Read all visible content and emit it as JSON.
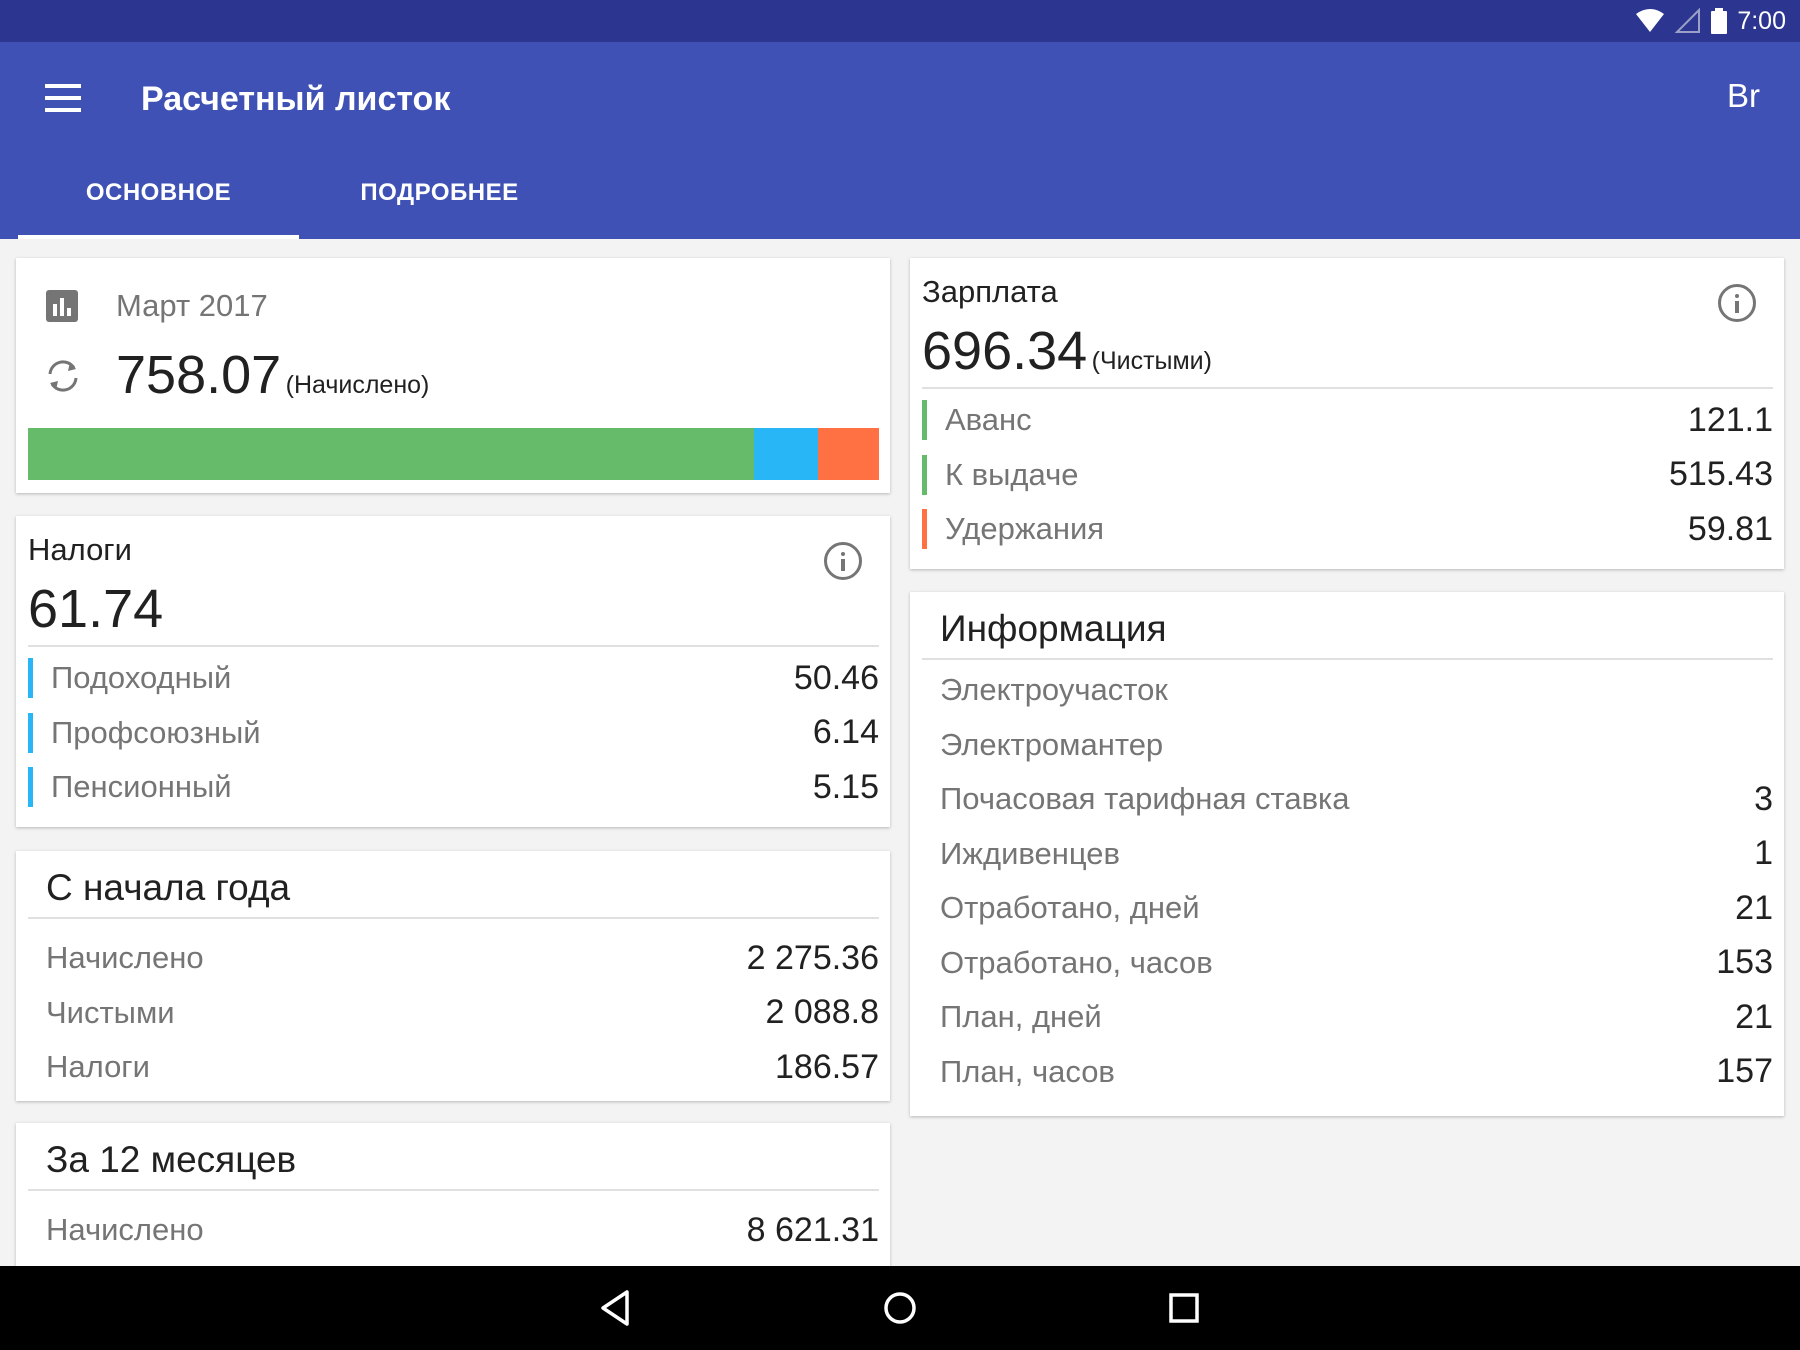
{
  "status_bar": {
    "time": "7:00"
  },
  "app_bar": {
    "title": "Расчетный листок",
    "currency": "Br",
    "tabs": [
      {
        "label": "ОСНОВНОЕ",
        "selected": true
      },
      {
        "label": "ПОДРОБНЕЕ",
        "selected": false
      }
    ]
  },
  "summary": {
    "period": "Март 2017",
    "total": "758.07",
    "total_note": "(Начислено)",
    "bar": [
      {
        "name": "net",
        "fraction": 0.853,
        "color": "#66bb6a"
      },
      {
        "name": "taxes",
        "fraction": 0.075,
        "color": "#29b6f6"
      },
      {
        "name": "deductions",
        "fraction": 0.072,
        "color": "#ff7043"
      }
    ]
  },
  "taxes": {
    "title": "Налоги",
    "total": "61.74",
    "items": [
      {
        "label": "Подоходный",
        "value": "50.46"
      },
      {
        "label": "Профсоюзный",
        "value": "6.14"
      },
      {
        "label": "Пенсионный",
        "value": "5.15"
      }
    ],
    "accent_color": "#29b6f6"
  },
  "ytd": {
    "title": "С начала года",
    "items": [
      {
        "label": "Начислено",
        "value": "2 275.36"
      },
      {
        "label": "Чистыми",
        "value": "2 088.8"
      },
      {
        "label": "Налоги",
        "value": "186.57"
      }
    ]
  },
  "months12": {
    "title": "За 12 месяцев",
    "items": [
      {
        "label": "Начислено",
        "value": "8 621.31"
      }
    ]
  },
  "salary": {
    "title": "Зарплата",
    "total": "696.34",
    "total_note": "(Чистыми)",
    "items": [
      {
        "label": "Аванс",
        "value": "121.1",
        "color": "#66bb6a"
      },
      {
        "label": "К выдаче",
        "value": "515.43",
        "color": "#66bb6a"
      },
      {
        "label": "Удержания",
        "value": "59.81",
        "color": "#ff7043"
      }
    ]
  },
  "info": {
    "title": "Информация",
    "items": [
      {
        "label": "Электроучасток",
        "value": ""
      },
      {
        "label": "Электромантер",
        "value": ""
      },
      {
        "label": "Почасовая тарифная ставка",
        "value": "3"
      },
      {
        "label": "Иждивенцев",
        "value": "1"
      },
      {
        "label": "Отработано, дней",
        "value": "21"
      },
      {
        "label": "Отработано, часов",
        "value": "153"
      },
      {
        "label": "План, дней",
        "value": "21"
      },
      {
        "label": "План, часов",
        "value": "157"
      }
    ]
  }
}
